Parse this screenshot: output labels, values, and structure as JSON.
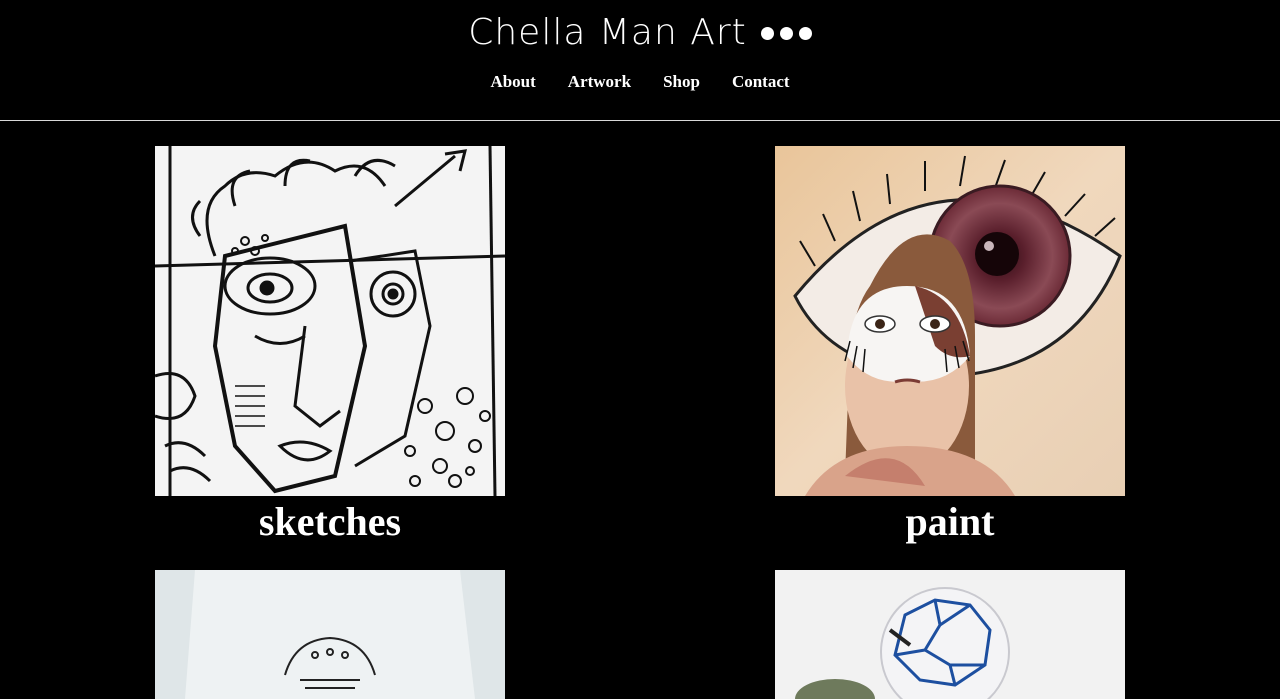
{
  "site": {
    "title": "Chella Man Art",
    "menu_icon": "three-dots-icon"
  },
  "nav": {
    "items": [
      {
        "label": "About"
      },
      {
        "label": "Artwork"
      },
      {
        "label": "Shop"
      },
      {
        "label": "Contact"
      }
    ]
  },
  "gallery": {
    "tiles": [
      {
        "label": "sketches",
        "image": "ink-sketch-face"
      },
      {
        "label": "paint",
        "image": "eye-painting-portrait"
      },
      {
        "label": "",
        "image": "printed-tshirt"
      },
      {
        "label": "",
        "image": "soccer-ball"
      }
    ]
  }
}
